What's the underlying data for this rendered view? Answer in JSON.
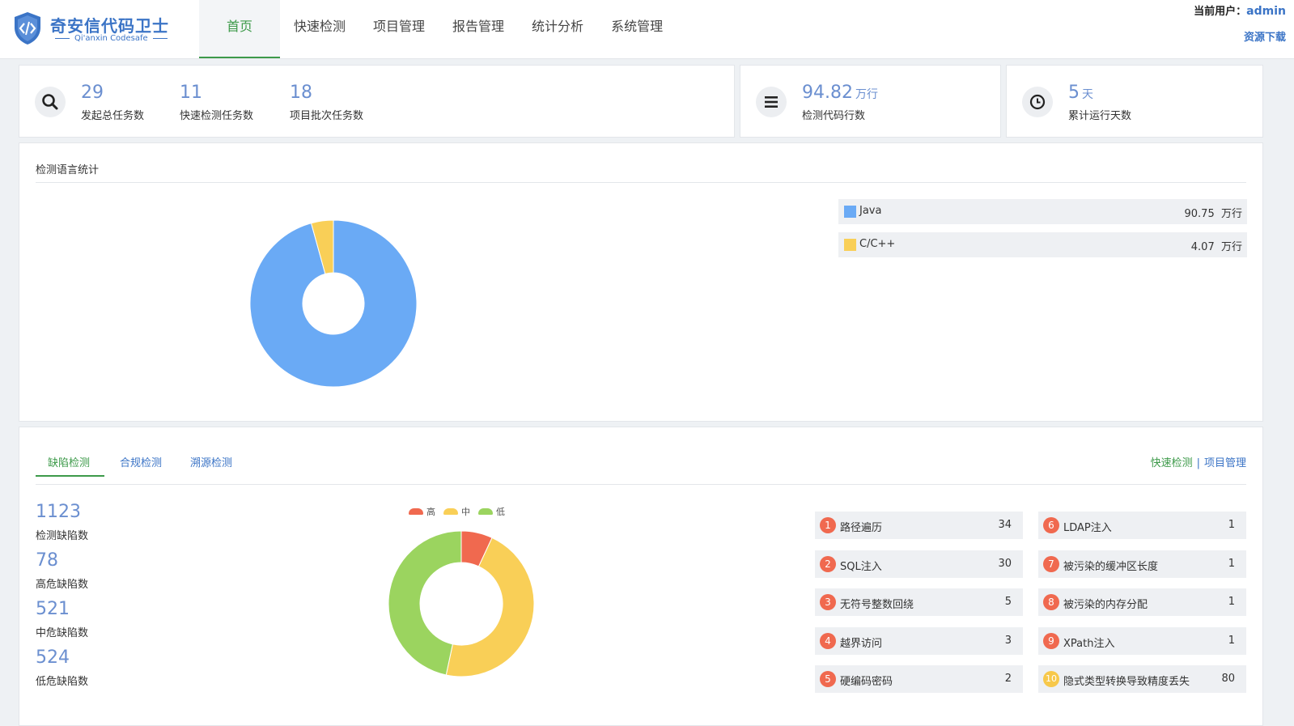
{
  "app": {
    "title": "奇安信代码卫士",
    "subtitle": "Qi'anxin Codesafe"
  },
  "nav": {
    "items": [
      "首页",
      "快速检测",
      "项目管理",
      "报告管理",
      "统计分析",
      "系统管理"
    ],
    "active": "首页"
  },
  "user": {
    "label": "当前用户：",
    "name": "admin",
    "download": "资源下载"
  },
  "stats": {
    "tasks": [
      {
        "value": "29",
        "label": "发起总任务数"
      },
      {
        "value": "11",
        "label": "快速检测任务数"
      },
      {
        "value": "18",
        "label": "项目批次任务数"
      }
    ],
    "code_lines": {
      "value": "94.82",
      "unit": "万行",
      "label": "检测代码行数"
    },
    "days": {
      "value": "5",
      "unit": "天",
      "label": "累计运行天数"
    }
  },
  "language_panel": {
    "title": "检测语言统计",
    "items": [
      {
        "name": "Java",
        "value": "90.75",
        "unit": "万行",
        "color": "#6aaaf5"
      },
      {
        "name": "C/C++",
        "value": "4.07",
        "unit": "万行",
        "color": "#f9cf57"
      }
    ]
  },
  "defect_panel": {
    "tabs": [
      "缺陷检测",
      "合规检测",
      "溯源检测"
    ],
    "active_tab": "缺陷检测",
    "links": [
      "快速检测",
      "项目管理"
    ],
    "link_separator": "|",
    "metrics": [
      {
        "value": "1123",
        "label": "检测缺陷数"
      },
      {
        "value": "78",
        "label": "高危缺陷数"
      },
      {
        "value": "521",
        "label": "中危缺陷数"
      },
      {
        "value": "524",
        "label": "低危缺陷数"
      }
    ],
    "severity_legend": [
      {
        "name": "高",
        "color": "#f0694f"
      },
      {
        "name": "中",
        "color": "#f9cf57"
      },
      {
        "name": "低",
        "color": "#9bd45f"
      }
    ],
    "top_vulns": [
      {
        "rank": "1",
        "name": "路径遍历",
        "count": "34"
      },
      {
        "rank": "2",
        "name": "SQL注入",
        "count": "30"
      },
      {
        "rank": "3",
        "name": "无符号整数回绕",
        "count": "5"
      },
      {
        "rank": "4",
        "name": "越界访问",
        "count": "3"
      },
      {
        "rank": "5",
        "name": "硬编码密码",
        "count": "2"
      },
      {
        "rank": "6",
        "name": "LDAP注入",
        "count": "1"
      },
      {
        "rank": "7",
        "name": "被污染的缓冲区长度",
        "count": "1"
      },
      {
        "rank": "8",
        "name": "被污染的内存分配",
        "count": "1"
      },
      {
        "rank": "9",
        "name": "XPath注入",
        "count": "1"
      },
      {
        "rank": "10",
        "name": "隐式类型转换导致精度丢失",
        "count": "80"
      }
    ]
  },
  "chart_data": [
    {
      "type": "pie",
      "title": "检测语言统计",
      "categories": [
        "Java",
        "C/C++"
      ],
      "values": [
        90.75,
        4.07
      ],
      "colors": [
        "#6aaaf5",
        "#f9cf57"
      ]
    },
    {
      "type": "pie",
      "categories": [
        "高",
        "中",
        "低"
      ],
      "values": [
        78,
        521,
        524
      ],
      "colors": [
        "#f0694f",
        "#f9cf57",
        "#9bd45f"
      ],
      "legend": "top"
    }
  ]
}
